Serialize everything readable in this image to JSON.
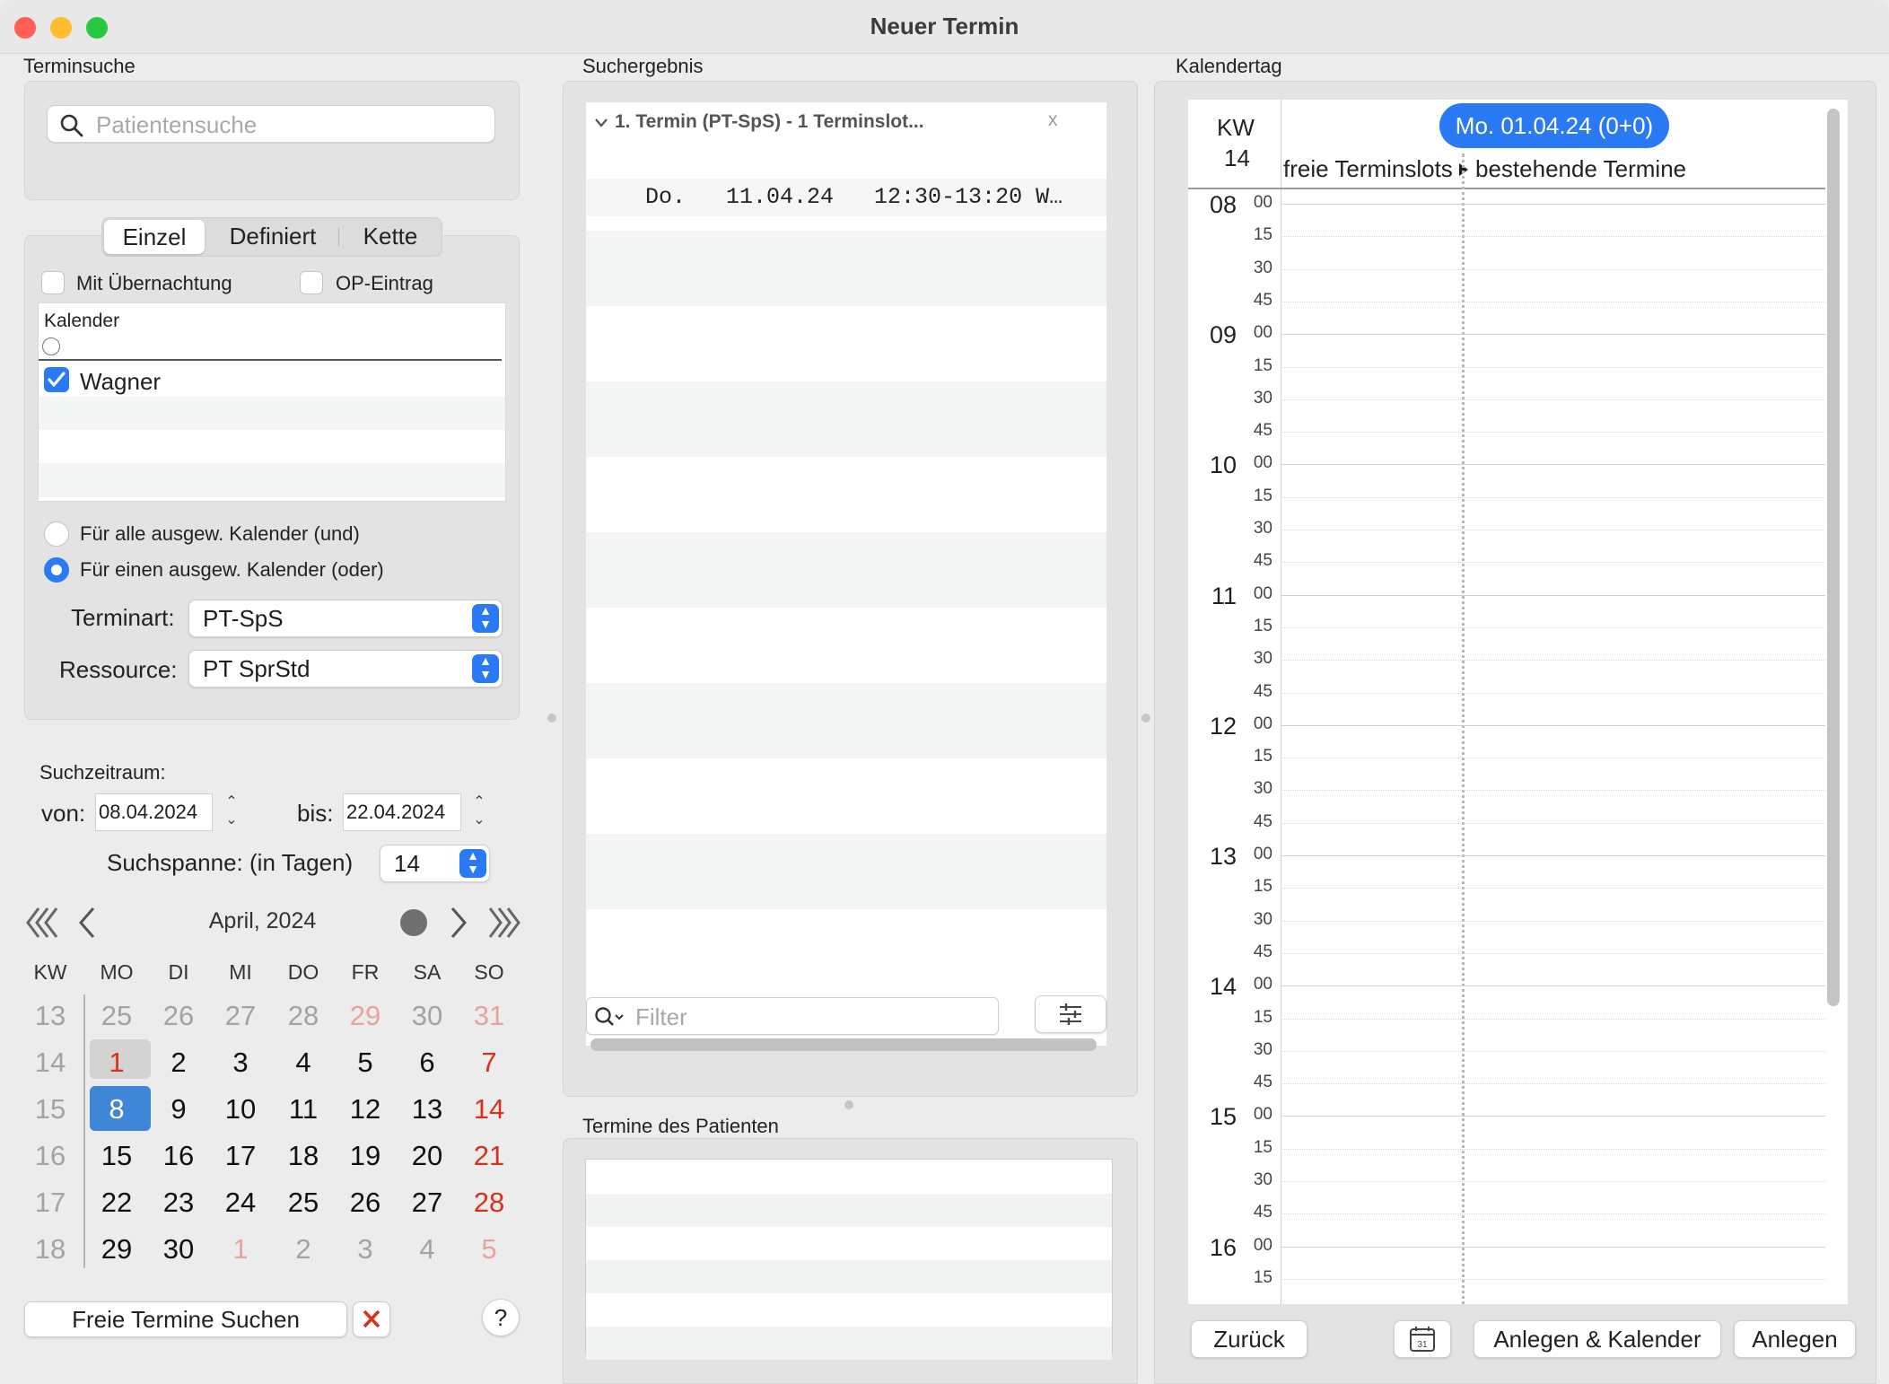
{
  "window": {
    "title": "Neuer Termin"
  },
  "terminsuche": {
    "section_label": "Terminsuche",
    "search_placeholder": "Patientensuche",
    "tabs": [
      "Einzel",
      "Definiert",
      "Kette"
    ],
    "selected_tab": "Einzel",
    "checkbox_uebernachtung": "Mit Übernachtung",
    "checkbox_op": "OP-Eintrag",
    "kalender_header": "Kalender",
    "kalender_items": [
      {
        "label": "Wagner",
        "checked": true
      }
    ],
    "radio_und": "Für alle ausgew. Kalender (und)",
    "radio_oder": "Für einen ausgew. Kalender (oder)",
    "terminart_label": "Terminart:",
    "terminart_value": "PT-SpS",
    "ressource_label": "Ressource:",
    "ressource_value": "PT SprStd"
  },
  "suchzeitraum": {
    "label": "Suchzeitraum:",
    "von_label": "von:",
    "von_value": "08.04.2024",
    "bis_label": "bis:",
    "bis_value": "22.04.2024",
    "spanne_label": "Suchspanne: (in Tagen)",
    "spanne_value": "14"
  },
  "mini_calendar": {
    "month_label": "April, 2024",
    "headers": [
      "KW",
      "MO",
      "DI",
      "MI",
      "DO",
      "FR",
      "SA",
      "SO"
    ],
    "weeks": [
      {
        "kw": "13",
        "days": [
          "25",
          "26",
          "27",
          "28",
          "29",
          "30",
          "31"
        ],
        "outside": true
      },
      {
        "kw": "14",
        "days": [
          "1",
          "2",
          "3",
          "4",
          "5",
          "6",
          "7"
        ],
        "outside": false
      },
      {
        "kw": "15",
        "days": [
          "8",
          "9",
          "10",
          "11",
          "12",
          "13",
          "14"
        ],
        "outside": false
      },
      {
        "kw": "16",
        "days": [
          "15",
          "16",
          "17",
          "18",
          "19",
          "20",
          "21"
        ],
        "outside": false
      },
      {
        "kw": "17",
        "days": [
          "22",
          "23",
          "24",
          "25",
          "26",
          "27",
          "28"
        ],
        "outside": false
      },
      {
        "kw": "18",
        "days": [
          "29",
          "30",
          "1",
          "2",
          "3",
          "4",
          "5"
        ],
        "outside": "partial"
      }
    ],
    "selected_day": "8",
    "today": "1"
  },
  "bottom_left": {
    "search_button": "Freie Termine Suchen",
    "help": "?"
  },
  "suchergebnis": {
    "section_label": "Suchergebnis",
    "group_header": "1. Termin (PT-SpS) - 1 Terminslot...",
    "close": "x",
    "results": [
      "Do.   11.04.24   12:30-13:20 W…"
    ],
    "filter_placeholder": "Filter"
  },
  "termine_patient": {
    "section_label": "Termine des Patienten"
  },
  "kalendertag": {
    "section_label": "Kalendertag",
    "kw_label": "KW",
    "kw_value": "14",
    "date_badge": "Mo. 01.04.24 (0+0)",
    "col_free": "freie Terminslots",
    "col_existing": "bestehende Termine",
    "hours": [
      "08",
      "09",
      "10",
      "11",
      "12",
      "13",
      "14",
      "15",
      "16"
    ],
    "minutes": [
      "00",
      "15",
      "30",
      "45"
    ]
  },
  "footer": {
    "back": "Zurück",
    "calendar_icon_day": "31",
    "create_calendar": "Anlegen & Kalender",
    "create": "Anlegen"
  },
  "colors": {
    "accent": "#2a7af5",
    "sunday": "#d9301c",
    "close_red": "#ff5f57",
    "minimize": "#febc2e",
    "zoom": "#28c840"
  }
}
